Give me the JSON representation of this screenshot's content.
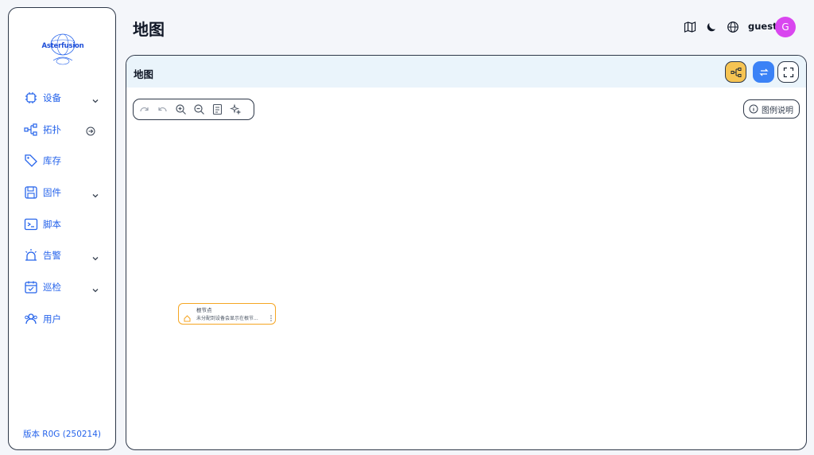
{
  "app": {
    "logo_text": "Asterfusion",
    "page_title": "地图",
    "version": "版本 R0G (250214)"
  },
  "sidebar": {
    "items": [
      {
        "label": "设备",
        "icon": "chip-icon",
        "has_chevron": true
      },
      {
        "label": "拓扑",
        "icon": "topology-icon",
        "has_circle_arrow": true
      },
      {
        "label": "库存",
        "icon": "tag-icon"
      },
      {
        "label": "固件",
        "icon": "save-icon",
        "has_chevron": true
      },
      {
        "label": "脚本",
        "icon": "terminal-icon"
      },
      {
        "label": "告警",
        "icon": "siren-icon",
        "has_chevron": true
      },
      {
        "label": "巡检",
        "icon": "calendar-check-icon",
        "has_chevron": true
      },
      {
        "label": "用户",
        "icon": "users-icon"
      }
    ]
  },
  "header": {
    "username": "guest",
    "avatar_letter": "G",
    "icons": [
      "map-icon",
      "moon-icon",
      "globe-icon"
    ],
    "avatar_color": "#d946ef"
  },
  "card": {
    "title": "地图",
    "legend_label": "图例说明",
    "buttons": [
      "topology-icon",
      "swap-icon",
      "fullscreen-icon"
    ]
  },
  "toolbar": {
    "icons": [
      "redo-icon",
      "undo-icon",
      "zoom-in-icon",
      "zoom-out-icon",
      "fit-icon",
      "sparkle-icon"
    ]
  },
  "node": {
    "title": "根节点",
    "description": "未分配到设备会显示在根节..."
  },
  "colors": {
    "accent": "#2563eb",
    "node_border": "#f5a623",
    "header_bg": "#eaf4fb"
  }
}
